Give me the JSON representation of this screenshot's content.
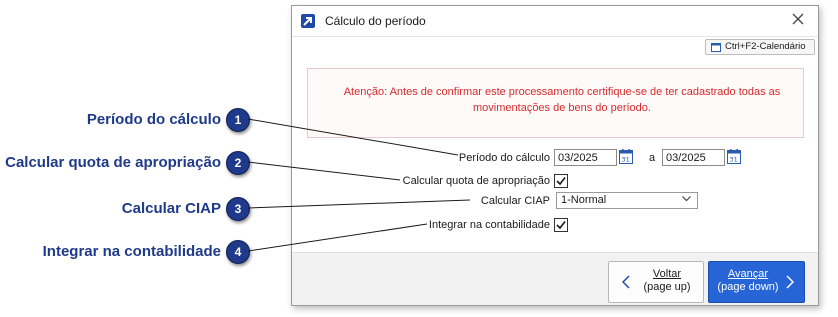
{
  "callouts": [
    {
      "label": "Período do cálculo",
      "number": "1"
    },
    {
      "label": "Calcular quota de apropriação",
      "number": "2"
    },
    {
      "label": "Calcular CIAP",
      "number": "3"
    },
    {
      "label": "Integrar na contabilidade",
      "number": "4"
    }
  ],
  "dialog": {
    "title": "Cálculo do período",
    "calendar_shortcut": "Ctrl+F2-Calendário",
    "warning": "Atenção: Antes de confirmar este processamento certifique-se de ter cadastrado todas as movimentações de bens do período.",
    "period": {
      "label": "Período do cálculo",
      "from": "03/2025",
      "separator": "a",
      "to": "03/2025"
    },
    "quota": {
      "label": "Calcular quota de apropriação",
      "checked": true
    },
    "ciap": {
      "label": "Calcular CIAP",
      "value": "1-Normal"
    },
    "integrar": {
      "label": "Integrar na contabilidade",
      "checked": true
    },
    "buttons": {
      "back_label": "Voltar",
      "back_shortcut": "(page up)",
      "next_label": "Avançar",
      "next_shortcut": "(page down)"
    }
  },
  "colors": {
    "callout": "#1f3a8a",
    "warning": "#d42b2b",
    "primary_button": "#2765d6"
  }
}
